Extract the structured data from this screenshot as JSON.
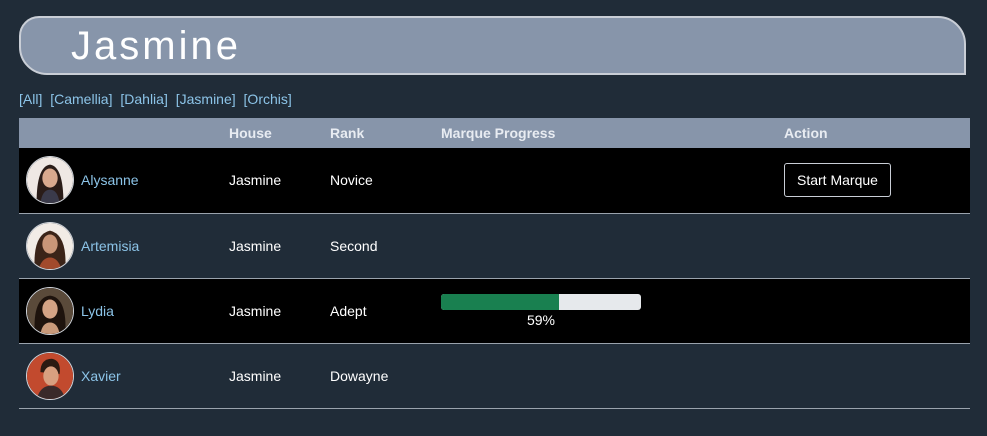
{
  "banner": {
    "title": "Jasmine"
  },
  "filters": [
    "[All]",
    "[Camellia]",
    "[Dahlia]",
    "[Jasmine]",
    "[Orchis]"
  ],
  "table": {
    "headers": [
      "",
      "House",
      "Rank",
      "Marque Progress",
      "Action"
    ],
    "rows": [
      {
        "name": "Alysanne",
        "house": "Jasmine",
        "rank": "Novice",
        "progress": null,
        "action": "Start Marque"
      },
      {
        "name": "Artemisia",
        "house": "Jasmine",
        "rank": "Second",
        "progress": null,
        "action": null
      },
      {
        "name": "Lydia",
        "house": "Jasmine",
        "rank": "Adept",
        "progress": 0.59,
        "progress_label": "59%",
        "action": null
      },
      {
        "name": "Xavier",
        "house": "Jasmine",
        "rank": "Dowayne",
        "progress": null,
        "action": null
      }
    ]
  },
  "colors": {
    "background": "#202c38",
    "header_bar": "#8795aa",
    "link": "#8cc4e8",
    "progress_fill": "#198050"
  }
}
